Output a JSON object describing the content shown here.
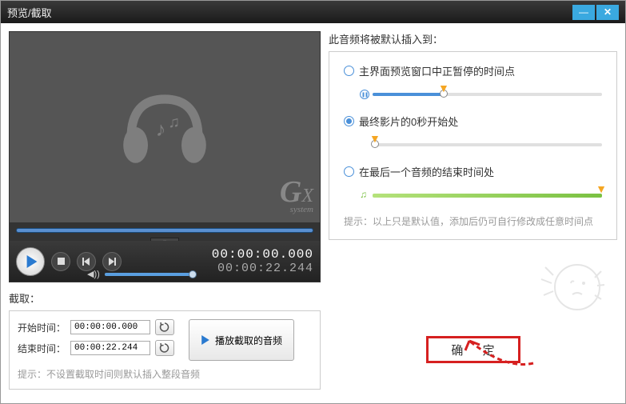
{
  "titlebar": {
    "title": "预览/截取"
  },
  "preview": {
    "watermark_main": "GX",
    "watermark_sub": "system"
  },
  "controls": {
    "current_time": "00:00:00.000",
    "total_time": "00:00:22.244"
  },
  "cut": {
    "section_label": "截取：",
    "start_label": "开始时间：",
    "start_value": "00:00:00.000",
    "end_label": "结束时间：",
    "end_value": "00:00:22.244",
    "play_cut_label": "播放截取的音频",
    "hint": "提示：不设置截取时间则默认插入整段音频"
  },
  "insert": {
    "heading": "此音频将被默认插入到：",
    "opt1": "主界面预览窗口中正暂停的时间点",
    "opt2": "最终影片的0秒开始处",
    "opt3": "在最后一个音频的结束时间处",
    "selected": 1,
    "hint": "提示：以上只是默认值，添加后仍可自行修改成任意时间点"
  },
  "ok_label": "确 定"
}
